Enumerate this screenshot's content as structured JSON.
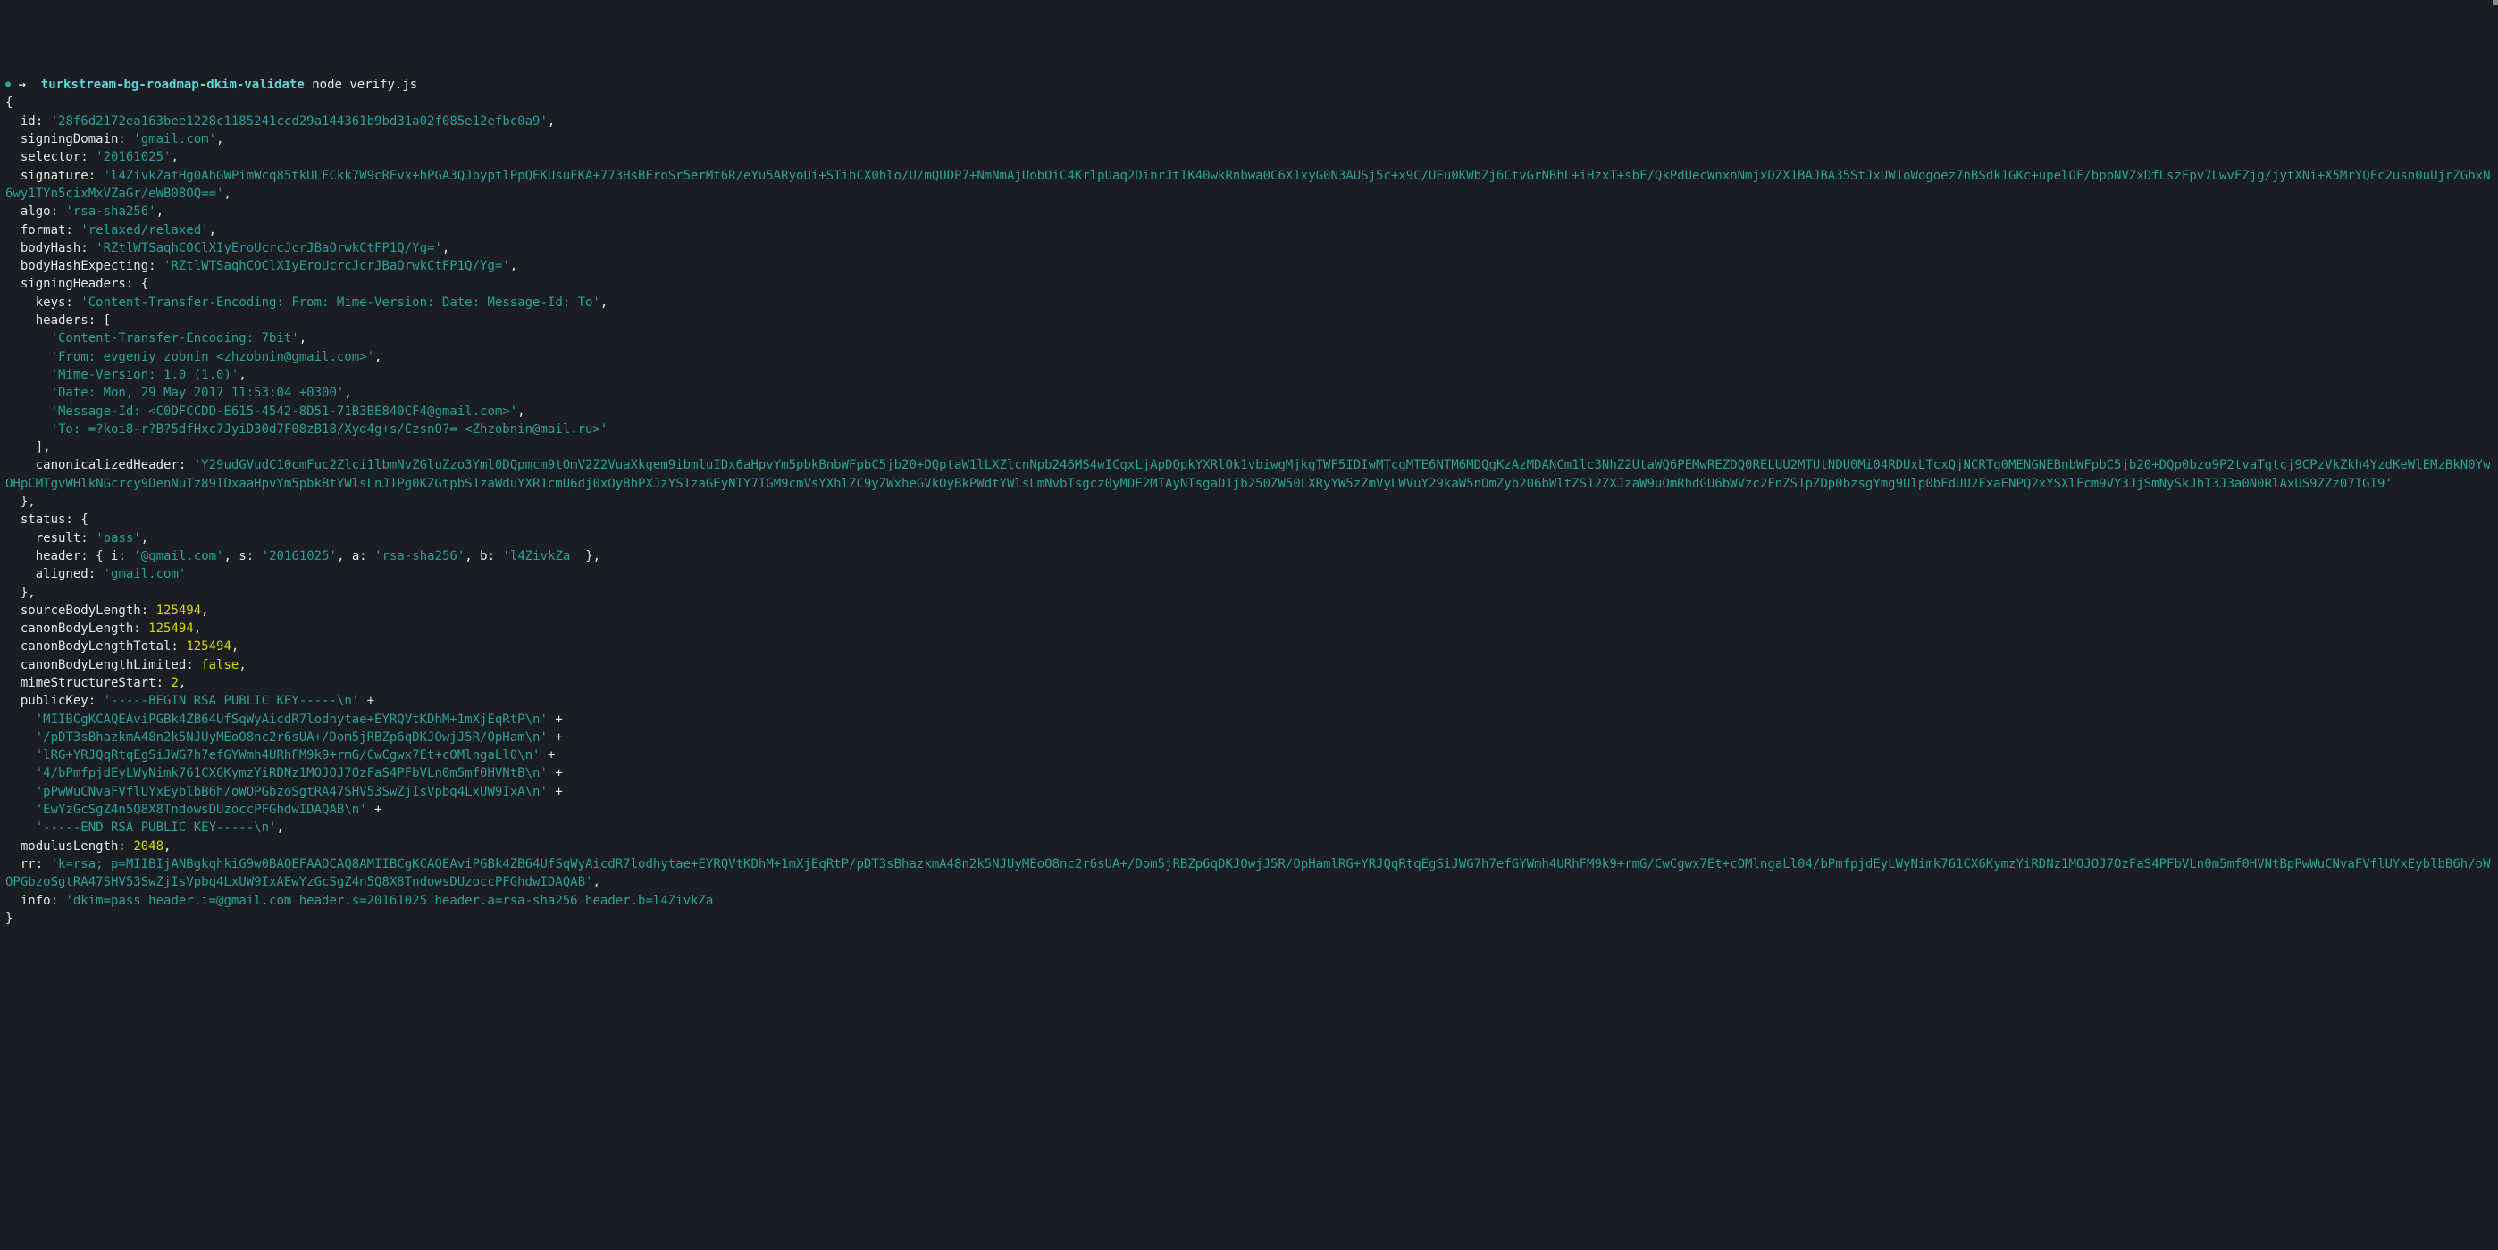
{
  "prompt": {
    "dot": "●",
    "arrow": "→",
    "cwd": "turkstream-bg-roadmap-dkim-validate",
    "command": "node verify.js"
  },
  "output": {
    "id": "'28f6d2172ea163bee1228c1185241ccd29a144361b9bd31a02f085e12efbc0a9'",
    "signingDomain": "'gmail.com'",
    "selector": "'20161025'",
    "signature": "'l4ZivkZatHg0AhGWPimWcq85tkULFCkk7W9cREvx+hPGA3QJbyptlPpQEKUsuFKA+773HsBEroSr5erMt6R/eYu5ARyoUi+STihCX0hlo/U/mQUDP7+NmNmAjUobOiC4KrlpUaq2DinrJtIK40wkRnbwa0C6X1xyG0N3AUSj5c+x9C/UEu0KWbZj6CtvGrNBhL+iHzxT+sbF/QkPdUecWnxnNmjxDZX1BAJBA35StJxUW1oWogoez7nBSdk1GKc+upelOF/bppNVZxDfLszFpv7LwvFZjg/jytXNi+X5MrYQFc2usn0uUjrZGhxN6wy1TYn5cixMxVZaGr/eWB08OQ=='",
    "algo": "'rsa-sha256'",
    "format": "'relaxed/relaxed'",
    "bodyHash": "'RZtlWTSaqhCOClXIyEroUcrcJcrJBaOrwkCtFP1Q/Yg='",
    "bodyHashExpecting": "'RZtlWTSaqhCOClXIyEroUcrcJcrJBaOrwkCtFP1Q/Yg='",
    "signingHeaders": {
      "keys": "'Content-Transfer-Encoding: From: Mime-Version: Date: Message-Id: To'",
      "headers": [
        "'Content-Transfer-Encoding: 7bit'",
        "'From: evgeniy zobnin <zhzobnin@gmail.com>'",
        "'Mime-Version: 1.0 (1.0)'",
        "'Date: Mon, 29 May 2017 11:53:04 +0300'",
        "'Message-Id: <C0DFCCDD-E615-4542-8D51-71B3BE840CF4@gmail.com>'",
        "'To: =?koi8-r?B?5dfHxc7JyiD30d7F08zB18/Xyd4g+s/CzsnO?= <Zhzobnin@mail.ru>'"
      ],
      "canonicalizedHeader": "'Y29udGVudC10cmFuc2Zlci1lbmNvZGluZzo3Yml0DQpmcm9tOmV2Z2VuaXkgem9ibmluIDx6aHpvYm5pbkBnbWFpbC5jb20+DQptaW1lLXZlcnNpb246MS4wICgxLjApDQpkYXRlOk1vbiwgMjkgTWF5IDIwMTcgMTE6NTM6MDQgKzAzMDANCm1lc3NhZ2UtaWQ6PEMwREZDQ0RELUU2MTUtNDU0Mi04RDUxLTcxQjNCRTg0MENGNEBnbWFpbC5jb20+DQp0bzo9P2tvaTgtcj9CPzVkZkh4YzdKeWlEMzBkN0YwOHpCMTgvWHlkNGcrcy9DenNuTz89IDxaaHpvYm5pbkBtYWlsLnJ1Pg0KZGtpbS1zaWduYXR1cmU6dj0xOyBhPXJzYS1zaGEyNTY7IGM9cmVsYXhlZC9yZWxheGVkOyBkPWdtYWlsLmNvbTsgcz0yMDE2MTAyNTsgaD1jb250ZW50LXRyYW5zZmVyLWVuY29kaW5nOmZyb206bWltZS12ZXJzaW9uOmRhdGU6bWVzc2FnZS1pZDp0bzsgYmg9Ulp0bFdUU2FxaENPQ2xYSXlFcm9VY3JjSmNySkJhT3J3a0N0RlAxUS9ZZz07IGI9'"
    },
    "status": {
      "result": "'pass'",
      "header": {
        "i": "'@gmail.com'",
        "s": "'20161025'",
        "a": "'rsa-sha256'",
        "b": "'l4ZivkZa'"
      },
      "aligned": "'gmail.com'"
    },
    "sourceBodyLength": "125494",
    "canonBodyLength": "125494",
    "canonBodyLengthTotal": "125494",
    "canonBodyLengthLimited": "false",
    "mimeStructureStart": "2",
    "publicKey": {
      "l0": "'-----BEGIN RSA PUBLIC KEY-----\\n'",
      "l1": "'MIIBCgKCAQEAviPGBk4ZB64UfSqWyAicdR7lodhytae+EYRQVtKDhM+1mXjEqRtP\\n'",
      "l2": "'/pDT3sBhazkmA48n2k5NJUyMEoO8nc2r6sUA+/Dom5jRBZp6qDKJOwjJ5R/OpHam\\n'",
      "l3": "'lRG+YRJQqRtqEgSiJWG7h7efGYWmh4URhFM9k9+rmG/CwCgwx7Et+cOMlngaLl0\\n'",
      "l4": "'4/bPmfpjdEyLWyNimk761CX6KymzYiRDNz1MOJOJ7OzFaS4PFbVLn0m5mf0HVNtB\\n'",
      "l5": "'pPwWuCNvaFVflUYxEyblbB6h/oWOPGbzoSgtRA47SHV53SwZjIsVpbq4LxUW9IxA\\n'",
      "l6": "'EwYzGcSgZ4n5Q8X8TndowsDUzoccPFGhdwIDAQAB\\n'",
      "l7": "'-----END RSA PUBLIC KEY-----\\n'"
    },
    "modulusLength": "2048",
    "rr": "'k=rsa; p=MIIBIjANBgkqhkiG9w0BAQEFAAOCAQ8AMIIBCgKCAQEAviPGBk4ZB64UfSqWyAicdR7lodhytae+EYRQVtKDhM+1mXjEqRtP/pDT3sBhazkmA48n2k5NJUyMEoO8nc2r6sUA+/Dom5jRBZp6qDKJOwjJ5R/OpHamlRG+YRJQqRtqEgSiJWG7h7efGYWmh4URhFM9k9+rmG/CwCgwx7Et+cOMlngaLl04/bPmfpjdEyLWyNimk761CX6KymzYiRDNz1MOJOJ7OzFaS4PFbVLn0m5mf0HVNtBpPwWuCNvaFVflUYxEyblbB6h/oWOPGbzoSgtRA47SHV53SwZjIsVpbq4LxUW9IxAEwYzGcSgZ4n5Q8X8TndowsDUzoccPFGhdwIDAQAB'",
    "info": "'dkim=pass header.i=@gmail.com header.s=20161025 header.a=rsa-sha256 header.b=l4ZivkZa'"
  }
}
